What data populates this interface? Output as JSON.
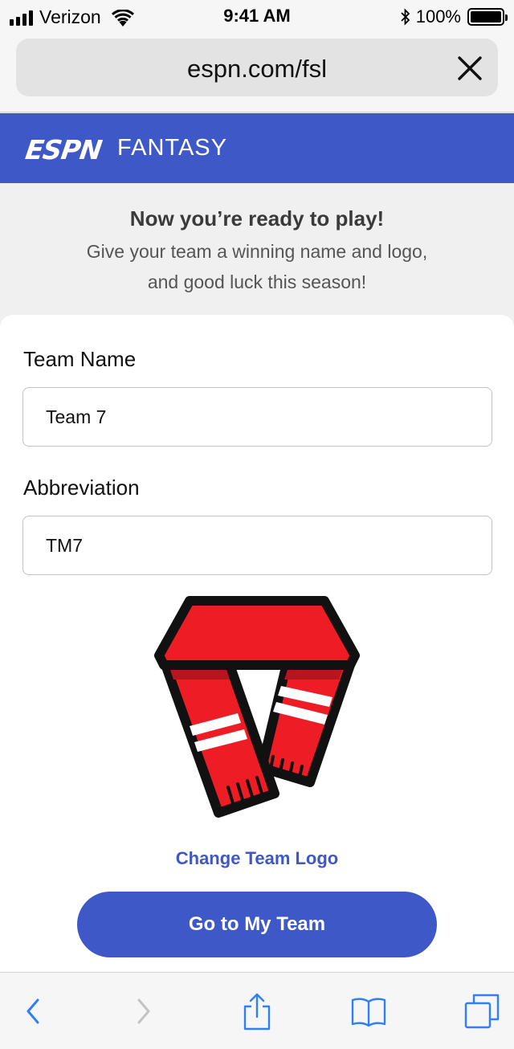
{
  "status_bar": {
    "carrier": "Verizon",
    "time": "9:41 AM",
    "battery": "100%"
  },
  "browser": {
    "url": "espn.com/fsl"
  },
  "header": {
    "brand": "ESPN",
    "section": "FANTASY"
  },
  "intro": {
    "title": "Now you’re ready to play!",
    "subtitle": "Give your team a winning name and logo, and good luck this season!"
  },
  "form": {
    "team_name_label": "Team Name",
    "team_name_value": "Team 7",
    "abbreviation_label": "Abbreviation",
    "abbreviation_value": "TM7",
    "change_logo_label": "Change Team Logo",
    "submit_label": "Go to My Team"
  },
  "colors": {
    "brand_blue": "#3e58c8",
    "scarf_red": "#ee1c25"
  },
  "icons": [
    "signal-icon",
    "wifi-icon",
    "bluetooth-icon",
    "battery-icon",
    "close-icon",
    "back-icon",
    "forward-icon",
    "share-icon",
    "bookmarks-icon",
    "tabs-icon",
    "scarf-logo"
  ]
}
